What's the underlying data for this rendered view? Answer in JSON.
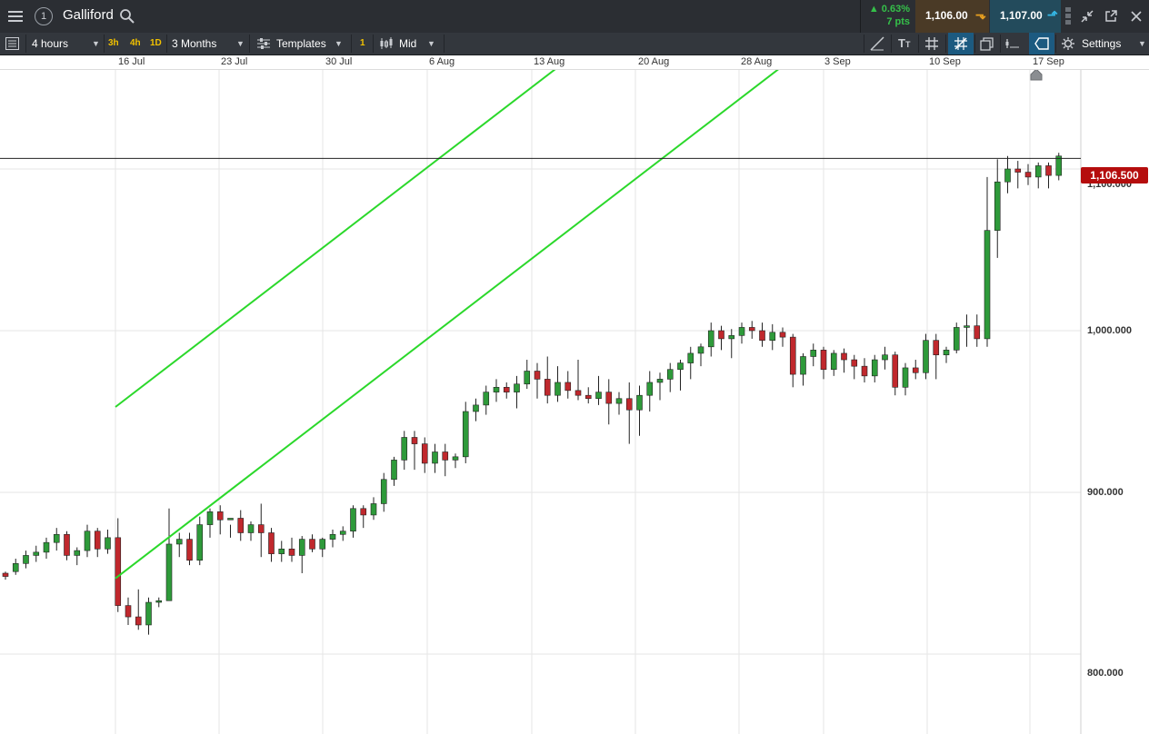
{
  "app": {
    "instrument": "Galliford",
    "alert_count": "1"
  },
  "quote": {
    "change_pct": "0.63%",
    "change_pts": "7 pts",
    "sell": "1,106.00",
    "buy": "1,107.00",
    "up_color": "#35c04a",
    "down_color": "#e8a020"
  },
  "toolbar": {
    "interval": "4 hours",
    "quick_intervals": [
      "3h",
      "4h",
      "1D"
    ],
    "range": "3 Months",
    "templates": "Templates",
    "layout_count": "1",
    "price_type": "Mid",
    "settings": "Settings"
  },
  "chart": {
    "current_price_label": "1,106.500",
    "current_price_color": "#b50d0d",
    "channel_color": "#2bd82b"
  },
  "chart_data": {
    "type": "candlestick",
    "x_dates": [
      "16 Jul",
      "23 Jul",
      "30 Jul",
      "6 Aug",
      "13 Aug",
      "20 Aug",
      "28 Aug",
      "3 Sep",
      "10 Sep",
      "17 Sep"
    ],
    "y_ticks": [
      "1,100.000",
      "1,000.000",
      "900.000",
      "800.000"
    ],
    "ylim": [
      770,
      1185
    ],
    "last_price": 1106.5,
    "channel_upper": [
      [
        4,
        920
      ],
      [
        46,
        1124
      ]
    ],
    "channel_lower": [
      [
        4,
        814
      ],
      [
        46,
        1018
      ]
    ],
    "grid": true,
    "candles": [
      [
        850,
        851,
        846,
        848
      ],
      [
        851,
        859,
        849,
        856
      ],
      [
        856,
        864,
        853,
        861
      ],
      [
        861,
        867,
        857,
        863
      ],
      [
        863,
        872,
        859,
        869
      ],
      [
        869,
        878,
        864,
        874
      ],
      [
        874,
        876,
        858,
        861
      ],
      [
        861,
        866,
        855,
        864
      ],
      [
        864,
        880,
        860,
        876
      ],
      [
        876,
        878,
        860,
        865
      ],
      [
        865,
        877,
        862,
        872
      ],
      [
        872,
        884,
        826,
        830
      ],
      [
        830,
        835,
        818,
        823
      ],
      [
        823,
        840,
        815,
        818
      ],
      [
        818,
        835,
        812,
        832
      ],
      [
        832,
        835,
        829,
        833
      ],
      [
        833,
        890,
        860,
        868
      ],
      [
        868,
        875,
        860,
        871
      ],
      [
        871,
        875,
        855,
        858
      ],
      [
        858,
        885,
        855,
        880
      ],
      [
        880,
        890,
        872,
        888
      ],
      [
        888,
        892,
        874,
        883
      ],
      [
        883,
        880,
        872,
        884
      ],
      [
        884,
        889,
        870,
        875
      ],
      [
        875,
        882,
        870,
        880
      ],
      [
        880,
        893,
        860,
        875
      ],
      [
        875,
        878,
        857,
        862
      ],
      [
        862,
        870,
        857,
        865
      ],
      [
        865,
        872,
        857,
        861
      ],
      [
        861,
        873,
        850,
        871
      ],
      [
        871,
        874,
        863,
        865
      ],
      [
        865,
        872,
        860,
        871
      ],
      [
        871,
        877,
        866,
        874
      ],
      [
        874,
        879,
        870,
        876
      ],
      [
        876,
        892,
        872,
        890
      ],
      [
        890,
        892,
        878,
        886
      ],
      [
        886,
        897,
        883,
        893
      ],
      [
        893,
        912,
        888,
        908
      ],
      [
        908,
        922,
        904,
        920
      ],
      [
        920,
        938,
        914,
        934
      ],
      [
        934,
        938,
        914,
        930
      ],
      [
        930,
        934,
        912,
        918
      ],
      [
        918,
        930,
        912,
        925
      ],
      [
        925,
        930,
        910,
        920
      ],
      [
        920,
        924,
        915,
        922
      ],
      [
        922,
        956,
        918,
        950
      ],
      [
        950,
        958,
        944,
        954
      ],
      [
        954,
        966,
        948,
        962
      ],
      [
        962,
        970,
        956,
        965
      ],
      [
        965,
        968,
        958,
        962
      ],
      [
        962,
        972,
        952,
        967
      ],
      [
        967,
        982,
        964,
        975
      ],
      [
        975,
        980,
        958,
        970
      ],
      [
        970,
        984,
        955,
        960
      ],
      [
        960,
        978,
        956,
        968
      ],
      [
        968,
        975,
        958,
        963
      ],
      [
        963,
        982,
        957,
        960
      ],
      [
        960,
        965,
        955,
        958
      ],
      [
        958,
        972,
        954,
        962
      ],
      [
        962,
        970,
        942,
        955
      ],
      [
        955,
        962,
        948,
        958
      ],
      [
        958,
        968,
        930,
        951
      ],
      [
        951,
        966,
        935,
        960
      ],
      [
        960,
        975,
        950,
        968
      ],
      [
        968,
        974,
        957,
        970
      ],
      [
        970,
        980,
        962,
        976
      ],
      [
        976,
        982,
        963,
        980
      ],
      [
        980,
        990,
        970,
        986
      ],
      [
        986,
        992,
        978,
        990
      ],
      [
        990,
        1005,
        984,
        1000
      ],
      [
        1000,
        1003,
        988,
        995
      ],
      [
        995,
        1001,
        983,
        997
      ],
      [
        997,
        1005,
        992,
        1002
      ],
      [
        1002,
        1006,
        995,
        1000
      ],
      [
        1000,
        1005,
        990,
        994
      ],
      [
        994,
        1004,
        988,
        999
      ],
      [
        999,
        1002,
        990,
        996
      ],
      [
        996,
        998,
        965,
        973
      ],
      [
        973,
        986,
        966,
        984
      ],
      [
        984,
        992,
        978,
        988
      ],
      [
        988,
        990,
        970,
        976
      ],
      [
        976,
        988,
        972,
        986
      ],
      [
        986,
        989,
        974,
        982
      ],
      [
        982,
        985,
        970,
        978
      ],
      [
        978,
        983,
        968,
        972
      ],
      [
        972,
        985,
        968,
        982
      ],
      [
        982,
        990,
        976,
        985
      ],
      [
        985,
        987,
        960,
        965
      ],
      [
        965,
        980,
        960,
        977
      ],
      [
        977,
        982,
        970,
        974
      ],
      [
        974,
        998,
        970,
        994
      ],
      [
        994,
        998,
        970,
        985
      ],
      [
        985,
        990,
        980,
        988
      ],
      [
        988,
        1005,
        986,
        1002
      ],
      [
        1002,
        1010,
        990,
        1003
      ],
      [
        1003,
        1010,
        990,
        995
      ],
      [
        995,
        1095,
        990,
        1062
      ],
      [
        1062,
        1106,
        1045,
        1092
      ],
      [
        1092,
        1108,
        1085,
        1100
      ],
      [
        1100,
        1105,
        1088,
        1098
      ],
      [
        1098,
        1103,
        1090,
        1095
      ],
      [
        1095,
        1104,
        1088,
        1102
      ],
      [
        1102,
        1104,
        1088,
        1096
      ],
      [
        1096,
        1110,
        1093,
        1108
      ]
    ]
  }
}
